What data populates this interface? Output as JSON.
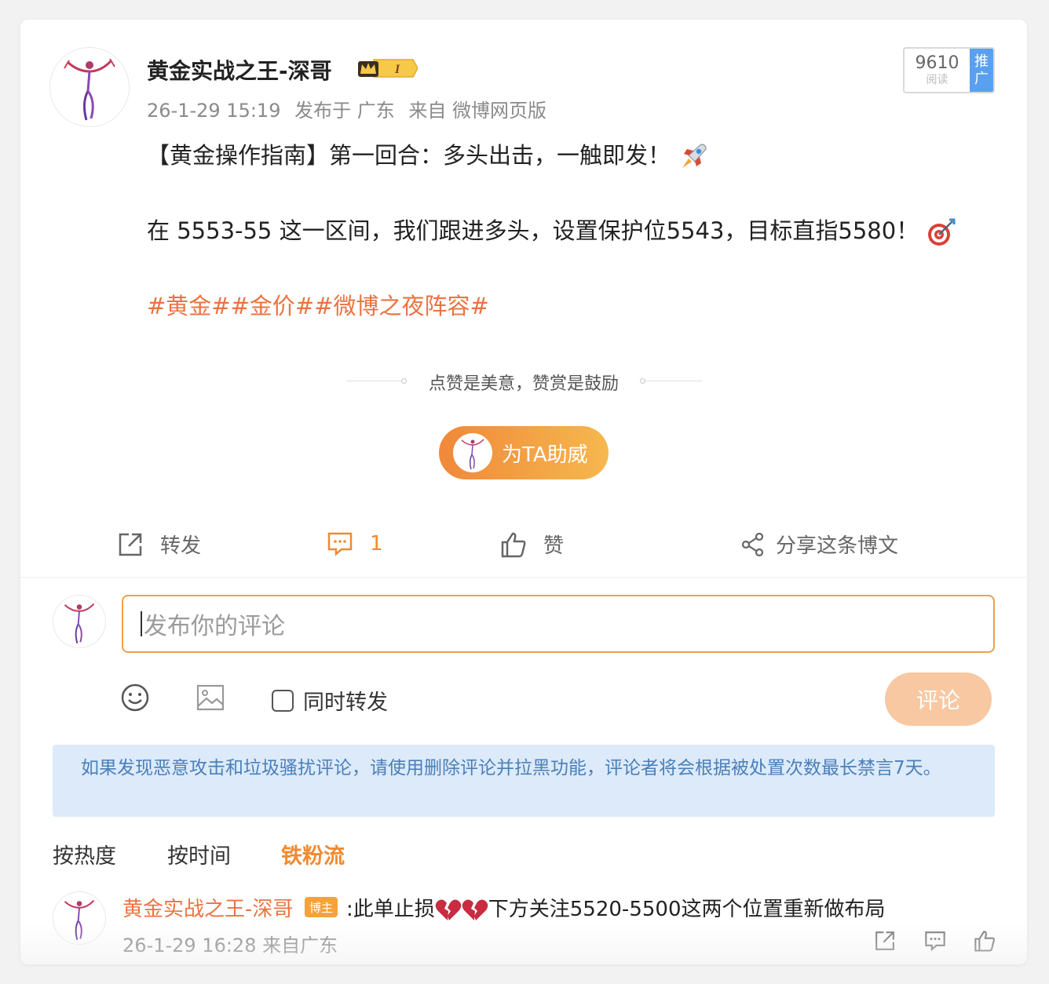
{
  "post": {
    "author": "黄金实战之王-深哥",
    "crown_level": "I",
    "timestamp": "26-1-29 15:19",
    "location": "发布于 广东",
    "source": "来自 微博网页版",
    "read_count": "9610",
    "read_label": "阅读",
    "promote_line1": "推",
    "promote_line2": "广",
    "line1": "【黄金操作指南】第一回合：多头出击，一触即发！",
    "line1_emoji": "rocket-icon",
    "line2": "在 5553-55 这一区间，我们跟进多头，设置保护位5543，目标直指5580！",
    "line2_emoji": "target-icon",
    "hashtags": "#黄金##金价##微博之夜阵容#"
  },
  "reward": {
    "tagline": "点赞是美意，赞赏是鼓励",
    "button_label": "为TA助威"
  },
  "actions": {
    "repost": "转发",
    "comment_count": "1",
    "like": "赞",
    "share": "分享这条博文"
  },
  "composer": {
    "placeholder": "发布你的评论",
    "also_repost": "同时转发",
    "submit": "评论"
  },
  "notice": "如果发现恶意攻击和垃圾骚扰评论，请使用删除评论并拉黑功能，评论者将会根据被处置次数最长禁言7天。",
  "sort_tabs": [
    "按热度",
    "按时间",
    "铁粉流"
  ],
  "active_sort": "铁粉流",
  "comments": [
    {
      "author": "黄金实战之王-深哥",
      "badge": "博主",
      "text_before": ":此单止损",
      "emojis": [
        "broken-heart-icon",
        "broken-heart-icon"
      ],
      "text_after": "下方关注5520-5500这两个位置重新做布局",
      "timestamp": "26-1-29 16:28",
      "source": "来自广东"
    }
  ],
  "colors": {
    "accent": "#f08a31",
    "hashtag": "#eb7340",
    "notice_bg": "#dceafa",
    "notice_text": "#4b7fb8",
    "promote_blue": "#5aa0f0"
  }
}
